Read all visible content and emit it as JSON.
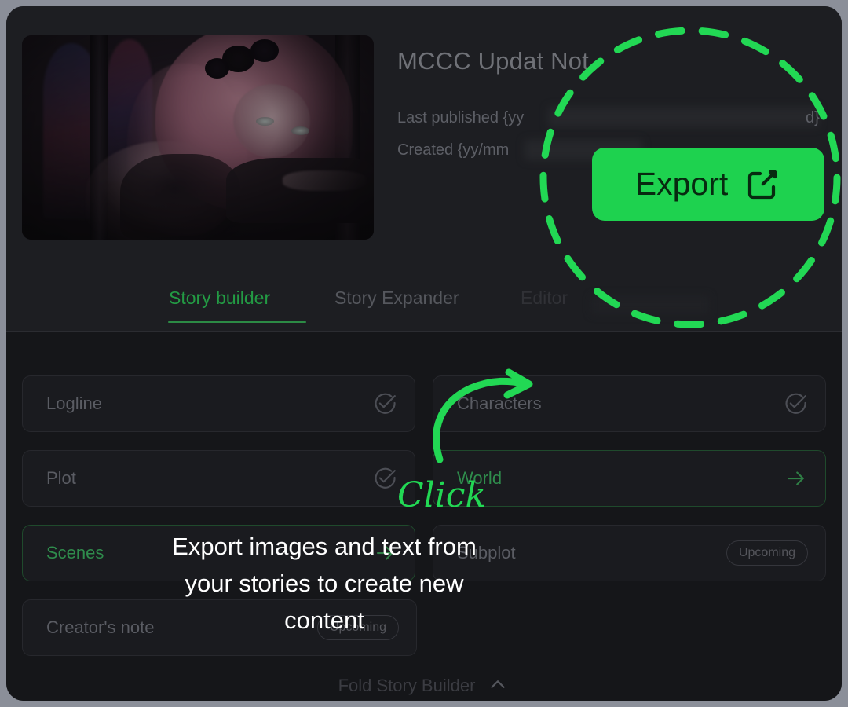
{
  "window": {
    "background_color": "#8b8f99",
    "panel_color": "#1a1b1f"
  },
  "accent": {
    "green": "#1ed24f",
    "green_dim": "#2c8b45",
    "green_text": "#239a44"
  },
  "header": {
    "title": "MCCC Updat Not",
    "meta": {
      "published_label": "Last published {yy",
      "published_tail": "d}",
      "created_label": "Created {yy/mm"
    },
    "cover_alt": "story-cover-art"
  },
  "export": {
    "label": "Export",
    "icon": "external-link-icon"
  },
  "tabs": [
    {
      "id": "story-builder",
      "label": "Story builder",
      "active": true
    },
    {
      "id": "story-expander",
      "label": "Story Expander",
      "active": false
    },
    {
      "id": "editor",
      "label": "Editor",
      "active": false
    }
  ],
  "cards": [
    {
      "id": "logline",
      "label": "Logline",
      "state": "done",
      "icon": "circle-check-icon"
    },
    {
      "id": "characters",
      "label": "Characters",
      "state": "done",
      "icon": "circle-check-icon"
    },
    {
      "id": "plot",
      "label": "Plot",
      "state": "done",
      "icon": "circle-check-icon"
    },
    {
      "id": "world",
      "label": "World",
      "state": "active",
      "icon": "arrow-right-icon"
    },
    {
      "id": "scenes",
      "label": "Scenes",
      "state": "active",
      "icon": "arrow-right-icon"
    },
    {
      "id": "subplot",
      "label": "Subplot",
      "state": "upcoming",
      "badge": "Upcoming"
    },
    {
      "id": "creators-note",
      "label": "Creator's note",
      "state": "upcoming",
      "badge": "Upcoming"
    }
  ],
  "fold": {
    "label": "Fold Story Builder",
    "icon": "chevron-up-icon"
  },
  "annotation": {
    "click_label": "Click",
    "caption": "Export images and text from your stories to create new content",
    "highlight": "dashed-circle-highlight",
    "arrow": "curved-arrow-icon"
  }
}
